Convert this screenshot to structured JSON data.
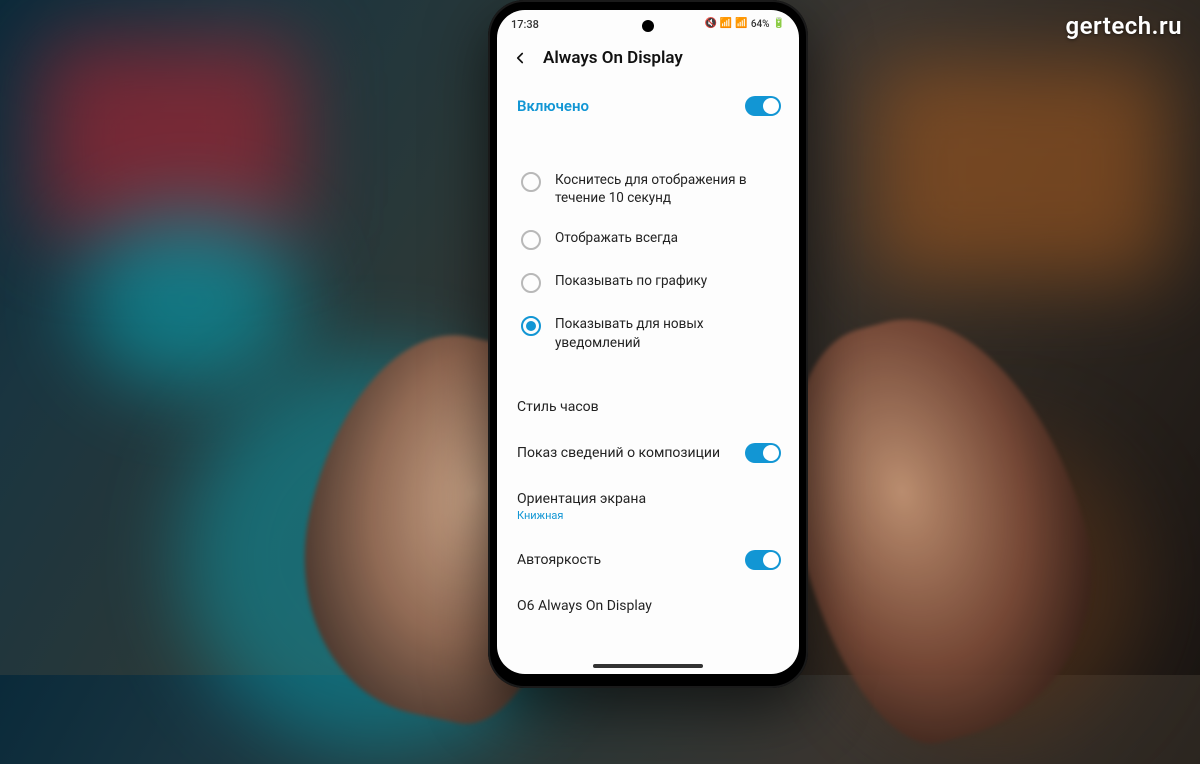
{
  "watermark": "gertech.ru",
  "status": {
    "time": "17:38",
    "battery_text": "64%"
  },
  "header": {
    "title": "Always On Display"
  },
  "master_toggle": {
    "label": "Включено",
    "value": true
  },
  "display_mode": {
    "selected_index": 3,
    "options": [
      "Коснитесь для отображения в течение 10 секунд",
      "Отображать всегда",
      "Показывать по графику",
      "Показывать для новых уведомлений"
    ]
  },
  "items": {
    "clock_style": {
      "label": "Стиль часов"
    },
    "music_info": {
      "label": "Показ сведений о композиции",
      "value": true
    },
    "orientation": {
      "label": "Ориентация экрана",
      "value_label": "Книжная"
    },
    "auto_brightness": {
      "label": "Автояркость",
      "value": true
    },
    "about": {
      "label": "О6 Always On Display"
    }
  }
}
